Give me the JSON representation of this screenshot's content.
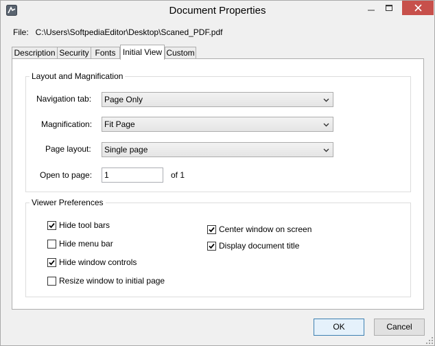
{
  "window": {
    "title": "Document Properties"
  },
  "file": {
    "label": "File:",
    "path": "C:\\Users\\SoftpediaEditor\\Desktop\\Scaned_PDF.pdf"
  },
  "tabs": [
    {
      "label": "Description"
    },
    {
      "label": "Security"
    },
    {
      "label": "Fonts"
    },
    {
      "label": "Initial View",
      "active": true
    },
    {
      "label": "Custom"
    }
  ],
  "layout_group": {
    "title": "Layout and Magnification",
    "navigation_tab": {
      "label": "Navigation tab:",
      "value": "Page Only"
    },
    "magnification": {
      "label": "Magnification:",
      "value": "Fit Page"
    },
    "page_layout": {
      "label": "Page layout:",
      "value": "Single page"
    },
    "open_to_page": {
      "label": "Open to page:",
      "value": "1",
      "of_text": "of 1"
    }
  },
  "viewer_group": {
    "title": "Viewer Preferences",
    "left_options": [
      {
        "label": "Hide tool bars",
        "checked": true
      },
      {
        "label": "Hide menu bar",
        "checked": false
      },
      {
        "label": "Hide window controls",
        "checked": true
      },
      {
        "label": "Resize window to initial page",
        "checked": false
      }
    ],
    "right_options": [
      {
        "label": "Center window on screen",
        "checked": true
      },
      {
        "label": "Display document title",
        "checked": true
      }
    ]
  },
  "buttons": {
    "ok": "OK",
    "cancel": "Cancel"
  },
  "icons": {
    "app": "pdf-app-icon",
    "minimize": "minimize-icon",
    "maximize": "maximize-icon",
    "close": "close-icon",
    "dropdown": "chevron-down-icon",
    "check": "checkmark-icon"
  },
  "colors": {
    "close_button": "#c7504b",
    "default_button_border": "#3c7fb1"
  }
}
